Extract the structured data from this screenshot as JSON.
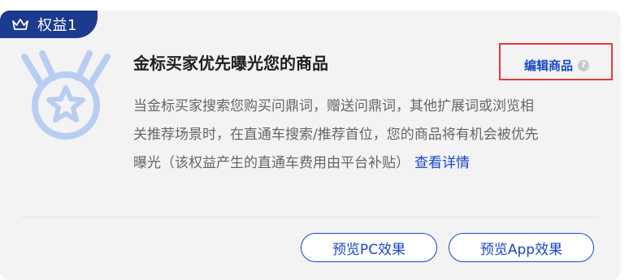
{
  "card": {
    "tag_label": "权益1",
    "title": "金标买家优先曝光您的商品",
    "edit_link": "编辑商品",
    "help_icon_glyph": "?",
    "description_lines": [
      "当金标买家搜索您购买问鼎词，赠送问鼎词，其他扩展词或浏览相",
      "关推荐场景时，在直通车搜索/推荐首位，您的商品将有机会被优先",
      "曝光（该权益产生的直通车费用由平台补贴）"
    ],
    "details_link": "查看详情",
    "buttons": {
      "preview_pc": "预览PC效果",
      "preview_app": "预览App效果"
    }
  },
  "icons": {
    "tag": "crown-icon",
    "medal": "medal-star-icon",
    "help": "question-circle-icon"
  },
  "colors": {
    "tag_bg": "#1c3a8f",
    "accent": "#1a47c8",
    "highlight_border": "#e53935",
    "medal": "#b9cdf3",
    "card_bg": "#f3f3f4"
  }
}
